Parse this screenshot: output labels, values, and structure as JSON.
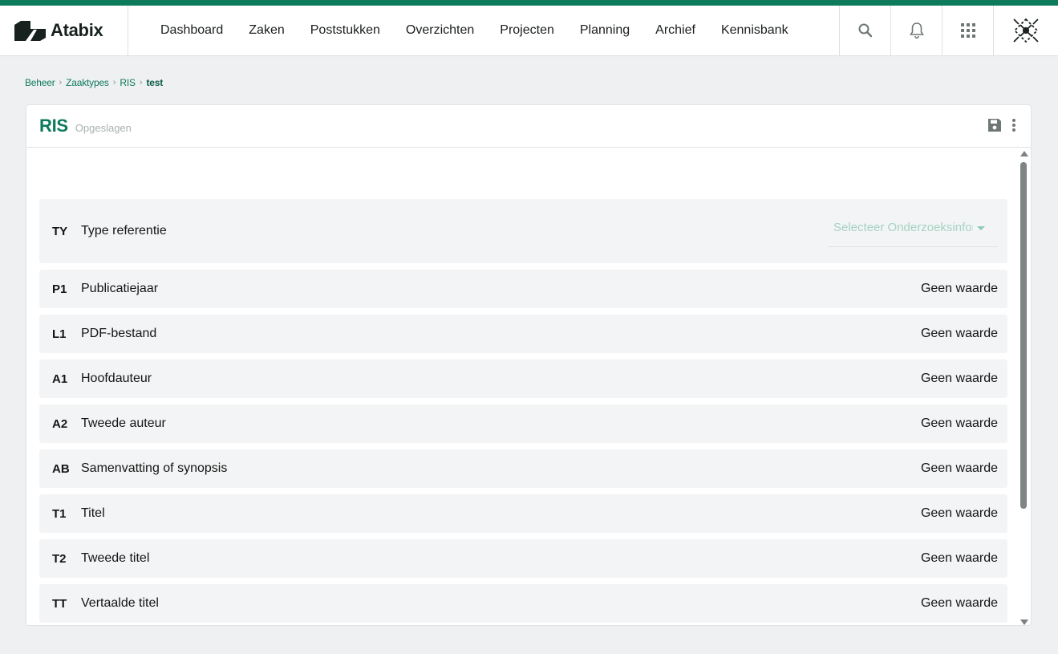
{
  "app": {
    "brand_name": "Atabix",
    "accent_color": "#0e7a5c"
  },
  "nav": {
    "items": [
      {
        "label": "Dashboard"
      },
      {
        "label": "Zaken"
      },
      {
        "label": "Poststukken"
      },
      {
        "label": "Overzichten"
      },
      {
        "label": "Projecten"
      },
      {
        "label": "Planning"
      },
      {
        "label": "Archief"
      },
      {
        "label": "Kennisbank"
      }
    ],
    "icons": [
      "search-icon",
      "bell-icon",
      "apps-grid-icon",
      "user-avatar"
    ]
  },
  "breadcrumb": {
    "items": [
      "Beheer",
      "Zaaktypes",
      "RIS"
    ],
    "current": "test"
  },
  "card": {
    "title": "RIS",
    "status": "Opgeslagen",
    "actions": [
      "save-icon",
      "more-vertical-icon"
    ]
  },
  "type_row": {
    "code": "TY",
    "label": "Type referentie",
    "select_placeholder": "Selecteer Onderzoeksinformatie"
  },
  "fields": [
    {
      "code": "P1",
      "label": "Publicatiejaar",
      "value": "Geen waarde"
    },
    {
      "code": "L1",
      "label": "PDF-bestand",
      "value": "Geen waarde"
    },
    {
      "code": "A1",
      "label": "Hoofdauteur",
      "value": "Geen waarde"
    },
    {
      "code": "A2",
      "label": "Tweede auteur",
      "value": "Geen waarde"
    },
    {
      "code": "AB",
      "label": "Samenvatting of synopsis",
      "value": "Geen waarde"
    },
    {
      "code": "T1",
      "label": "Titel",
      "value": "Geen waarde"
    },
    {
      "code": "T2",
      "label": "Tweede titel",
      "value": "Geen waarde"
    },
    {
      "code": "TT",
      "label": "Vertaalde titel",
      "value": "Geen waarde"
    }
  ]
}
